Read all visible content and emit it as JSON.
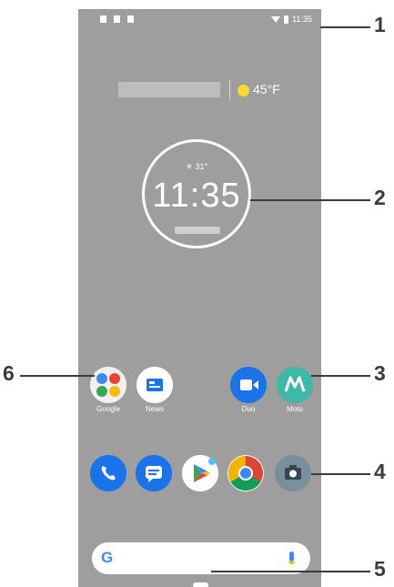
{
  "status_bar": {
    "time": "11:35"
  },
  "glance": {
    "temperature": "45°F"
  },
  "clock": {
    "weather": "☀ 31°",
    "time": "11:35"
  },
  "apps_row": [
    {
      "label": "Google",
      "icon": "google-folder-icon"
    },
    {
      "label": "News",
      "icon": "news-icon"
    },
    {
      "label": "Duo",
      "icon": "duo-icon"
    },
    {
      "label": "Moto",
      "icon": "moto-icon"
    }
  ],
  "dock": [
    {
      "icon": "phone-icon"
    },
    {
      "icon": "messages-icon"
    },
    {
      "icon": "play-store-icon"
    },
    {
      "icon": "chrome-icon"
    },
    {
      "icon": "camera-icon"
    }
  ],
  "search": {
    "g_label": "G"
  },
  "callouts": [
    "1",
    "2",
    "3",
    "4",
    "5",
    "6"
  ],
  "colors": {
    "screen_bg": "#9e9e9e",
    "accent_blue": "#1a73e8",
    "moto_teal": "#3fb8a8",
    "callout": "#3c3c3c"
  }
}
